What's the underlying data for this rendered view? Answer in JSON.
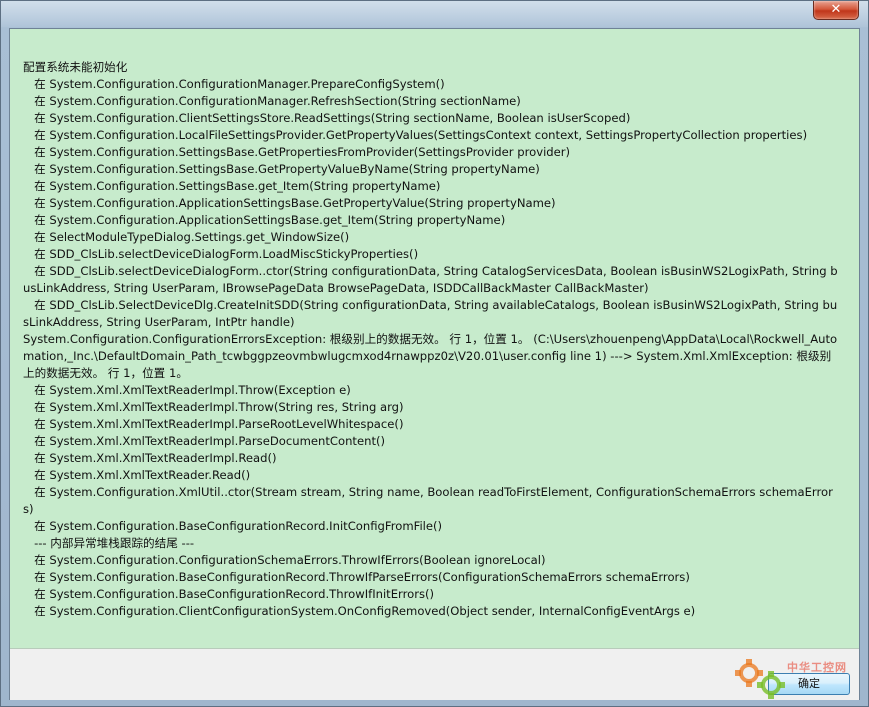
{
  "window": {
    "close_label": "✕"
  },
  "message": {
    "lines": [
      "配置系统未能初始化",
      "   在 System.Configuration.ConfigurationManager.PrepareConfigSystem()",
      "   在 System.Configuration.ConfigurationManager.RefreshSection(String sectionName)",
      "   在 System.Configuration.ClientSettingsStore.ReadSettings(String sectionName, Boolean isUserScoped)",
      "   在 System.Configuration.LocalFileSettingsProvider.GetPropertyValues(SettingsContext context, SettingsPropertyCollection properties)",
      "   在 System.Configuration.SettingsBase.GetPropertiesFromProvider(SettingsProvider provider)",
      "   在 System.Configuration.SettingsBase.GetPropertyValueByName(String propertyName)",
      "   在 System.Configuration.SettingsBase.get_Item(String propertyName)",
      "   在 System.Configuration.ApplicationSettingsBase.GetPropertyValue(String propertyName)",
      "   在 System.Configuration.ApplicationSettingsBase.get_Item(String propertyName)",
      "   在 SelectModuleTypeDialog.Settings.get_WindowSize()",
      "   在 SDD_ClsLib.selectDeviceDialogForm.LoadMiscStickyProperties()",
      "   在 SDD_ClsLib.selectDeviceDialogForm..ctor(String configurationData, String CatalogServicesData, Boolean isBusinWS2LogixPath, String busLinkAddress, String UserParam, IBrowsePageData BrowsePageData, ISDDCallBackMaster CallBackMaster)",
      "   在 SDD_ClsLib.SelectDeviceDlg.CreateInitSDD(String configurationData, String availableCatalogs, Boolean isBusinWS2LogixPath, String busLinkAddress, String UserParam, IntPtr handle)",
      "System.Configuration.ConfigurationErrorsException: 根级别上的数据无效。 行 1，位置 1。 (C:\\Users\\zhouenpeng\\AppData\\Local\\Rockwell_Automation,_Inc.\\DefaultDomain_Path_tcwbggpzeovmbwlugcmxod4rnawppz0z\\V20.01\\user.config line 1) ---> System.Xml.XmlException: 根级别上的数据无效。 行 1，位置 1。",
      "   在 System.Xml.XmlTextReaderImpl.Throw(Exception e)",
      "   在 System.Xml.XmlTextReaderImpl.Throw(String res, String arg)",
      "   在 System.Xml.XmlTextReaderImpl.ParseRootLevelWhitespace()",
      "   在 System.Xml.XmlTextReaderImpl.ParseDocumentContent()",
      "   在 System.Xml.XmlTextReaderImpl.Read()",
      "   在 System.Xml.XmlTextReader.Read()",
      "   在 System.Configuration.XmlUtil..ctor(Stream stream, String name, Boolean readToFirstElement, ConfigurationSchemaErrors schemaErrors)",
      "   在 System.Configuration.BaseConfigurationRecord.InitConfigFromFile()",
      "   --- 内部异常堆栈跟踪的结尾 ---",
      "   在 System.Configuration.ConfigurationSchemaErrors.ThrowIfErrors(Boolean ignoreLocal)",
      "   在 System.Configuration.BaseConfigurationRecord.ThrowIfParseErrors(ConfigurationSchemaErrors schemaErrors)",
      "   在 System.Configuration.BaseConfigurationRecord.ThrowIfInitErrors()",
      "   在 System.Configuration.ClientConfigurationSystem.OnConfigRemoved(Object sender, InternalConfigEventArgs e)"
    ]
  },
  "buttons": {
    "ok_label": "确定"
  },
  "watermark": {
    "text": "中华工控网",
    "icon": "gear-icon"
  },
  "colors": {
    "message_background": "#c7ebcc",
    "close_button": "#c8401f",
    "ok_button_border": "#3c7fb1"
  }
}
